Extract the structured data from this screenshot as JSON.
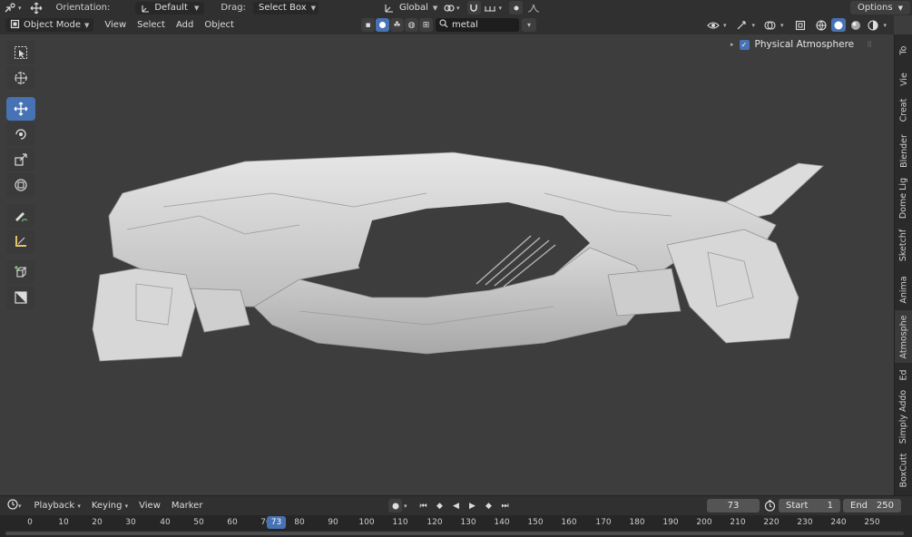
{
  "topbar": {
    "orientation_label": "Orientation:",
    "orientation_value": "Default",
    "drag_label": "Drag:",
    "drag_value": "Select Box",
    "transform_orientation": "Global",
    "options_label": "Options"
  },
  "viewport_header": {
    "mode": "Object Mode",
    "menus": [
      "View",
      "Select",
      "Add",
      "Object"
    ],
    "search_value": "metal"
  },
  "viewport": {
    "overlay_checkbox_label": "Physical Atmosphere",
    "overlay_checked": true
  },
  "toolbar": {
    "tools": [
      "select-box",
      "cursor",
      "move",
      "rotate",
      "scale",
      "transform",
      "annotate",
      "measure",
      "add-cube",
      "boxcutter"
    ],
    "active_tool": "move"
  },
  "sidetabs": [
    "To",
    "Vie",
    "Creat",
    "Blender",
    "Dome Lig",
    "Sketchf",
    "Anima",
    "Atmosphe",
    "Ed",
    "Simply Addo",
    "BoxCutt"
  ],
  "sidetab_active": "Atmosphe",
  "timeline": {
    "menus": [
      "Playback",
      "Keying",
      "View",
      "Marker"
    ],
    "current_frame": "73",
    "start_label": "Start",
    "start_value": "1",
    "end_label": "End",
    "end_value": "250",
    "ruler_marks": [
      "0",
      "10",
      "20",
      "30",
      "40",
      "50",
      "60",
      "70",
      "80",
      "90",
      "100",
      "110",
      "120",
      "130",
      "140",
      "150",
      "160",
      "170",
      "180",
      "190",
      "200",
      "210",
      "220",
      "230",
      "240",
      "250"
    ],
    "playhead_label": "73"
  },
  "colors": {
    "accent": "#4772b3",
    "background": "#3d3d3d",
    "header": "#303030"
  }
}
